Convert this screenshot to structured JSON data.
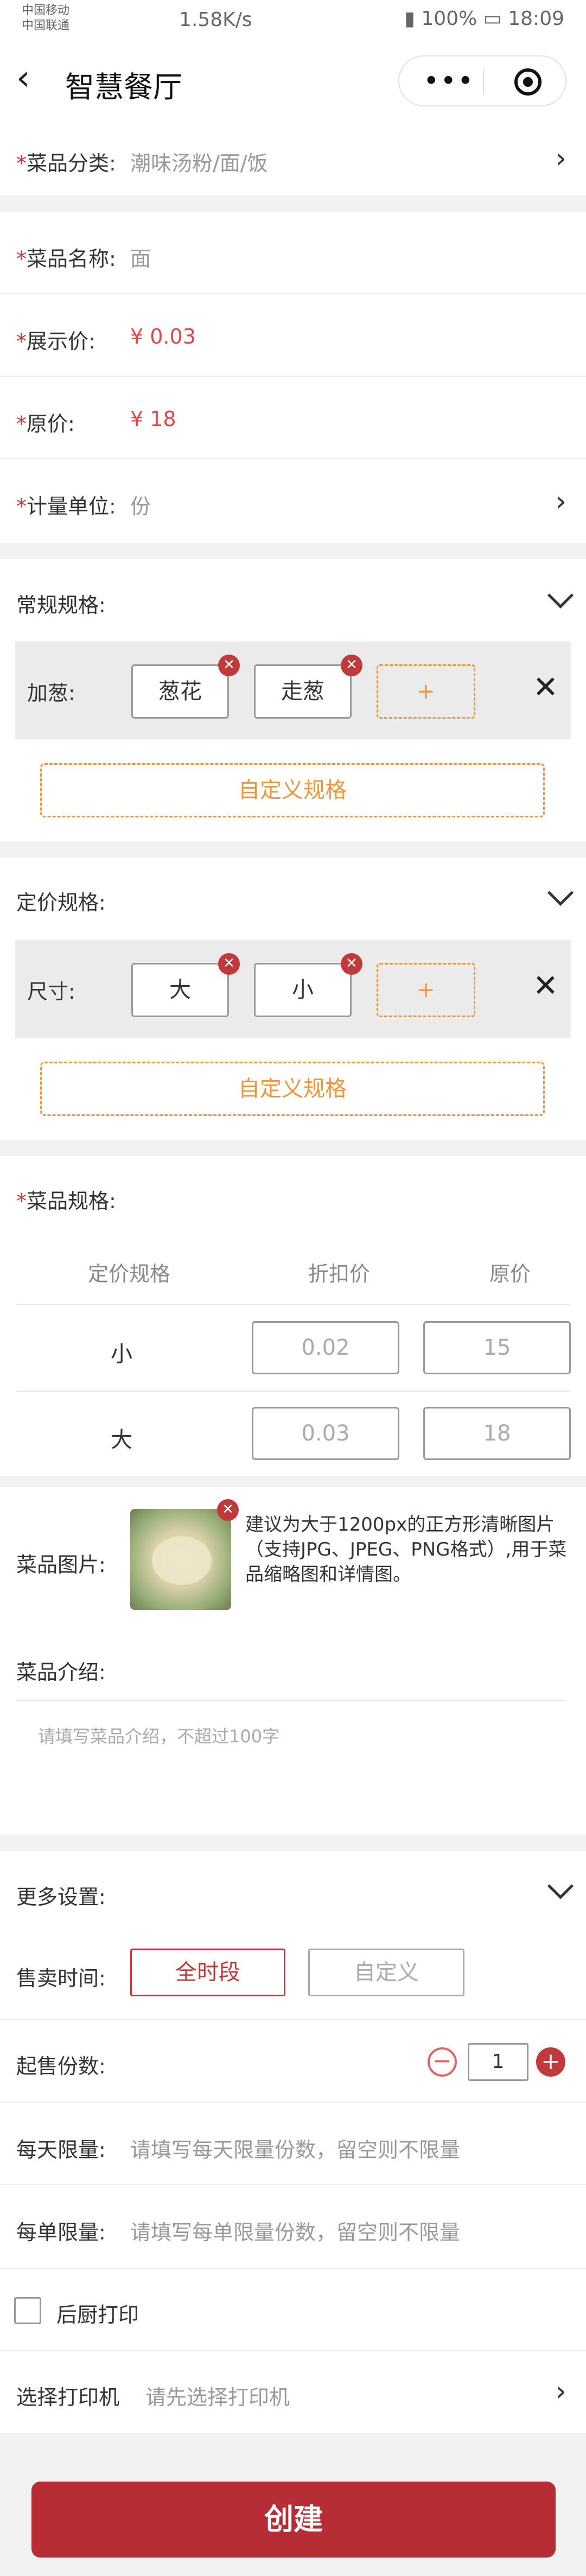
{
  "status": {
    "carrier1": "中国移动",
    "carrier2": "中国联通",
    "speed": "1.58K/s",
    "battery": "100%",
    "time": "18:09"
  },
  "nav": {
    "title": "智慧餐厅",
    "dots": "•••"
  },
  "form": {
    "category": {
      "label": "菜品分类:",
      "value": "潮味汤粉/面/饭"
    },
    "name": {
      "label": "菜品名称:",
      "value": "面"
    },
    "display_price": {
      "label": "展示价:",
      "value": "¥ 0.03"
    },
    "original_price": {
      "label": "原价:",
      "value": "¥ 18"
    },
    "unit": {
      "label": "计量单位:",
      "value": "份"
    },
    "required_mark": "*"
  },
  "regular_spec": {
    "title": "常规规格:",
    "group_name": "加葱:",
    "tags": [
      "葱花",
      "走葱"
    ],
    "add": "+",
    "custom": "自定义规格"
  },
  "priced_spec": {
    "title": "定价规格:",
    "group_name": "尺寸:",
    "tags": [
      "大",
      "小"
    ],
    "add": "+",
    "custom": "自定义规格"
  },
  "dish_spec": {
    "title": "菜品规格:",
    "headers": [
      "定价规格",
      "折扣价",
      "原价"
    ],
    "rows": [
      {
        "name": "小",
        "discount": "0.02",
        "original": "15"
      },
      {
        "name": "大",
        "discount": "0.03",
        "original": "18"
      }
    ]
  },
  "image": {
    "label": "菜品图片:",
    "hint": "建议为大于1200px的正方形清晰图片（支持JPG、JPEG、PNG格式）,用于菜品缩略图和详情图。"
  },
  "intro": {
    "label": "菜品介绍:",
    "placeholder": "请填写菜品介绍，不超过100字"
  },
  "more": {
    "title": "更多设置:",
    "sale_time_label": "售卖时间:",
    "sale_all": "全时段",
    "sale_custom": "自定义",
    "min_label": "起售份数:",
    "min_value": "1",
    "daily_label": "每天限量:",
    "daily_placeholder": "请填写每天限量份数，留空则不限量",
    "order_label": "每单限量:",
    "order_placeholder": "请填写每单限量份数，留空则不限量",
    "kitchen_print": "后厨打印",
    "printer_label": "选择打印机",
    "printer_placeholder": "请先选择打印机"
  },
  "submit": "创建"
}
